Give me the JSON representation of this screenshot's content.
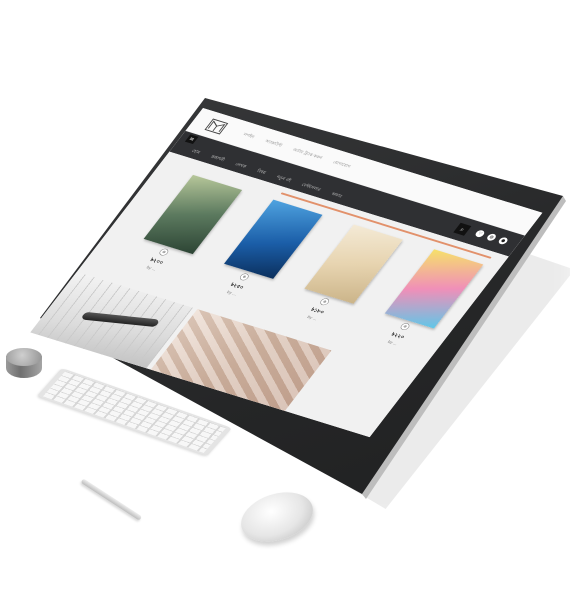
{
  "header": {
    "top_links": [
      "লগইন",
      "অ্যাকাউন্ট",
      "অর্ডার ট্র্যাক করুন",
      "যোগাযোগ"
    ],
    "search_icon": "search-icon",
    "header_icons": [
      "heart-icon",
      "cart-icon",
      "user-icon"
    ]
  },
  "nav": {
    "toggle_icon": "menu-icon",
    "items": [
      "হোম",
      "প্রকাশনী",
      "লেখক",
      "বিষয়",
      "নতুন বই",
      "বেস্টসেলার",
      "অফার"
    ]
  },
  "books": [
    {
      "cover_title": "",
      "price": "৳২০০",
      "title": "",
      "author": "by ..."
    },
    {
      "cover_title": "",
      "price": "৳২৫০",
      "title": "",
      "author": "by ..."
    },
    {
      "cover_title": "",
      "price": "৳১৮০",
      "title": "",
      "author": "by ..."
    },
    {
      "cover_title": "",
      "price": "৳২২০",
      "title": "",
      "author": "by ..."
    }
  ],
  "colors": {
    "navbar": "#2f3033",
    "accent": "#e2916b",
    "device_frame": "#2a2b2c"
  }
}
